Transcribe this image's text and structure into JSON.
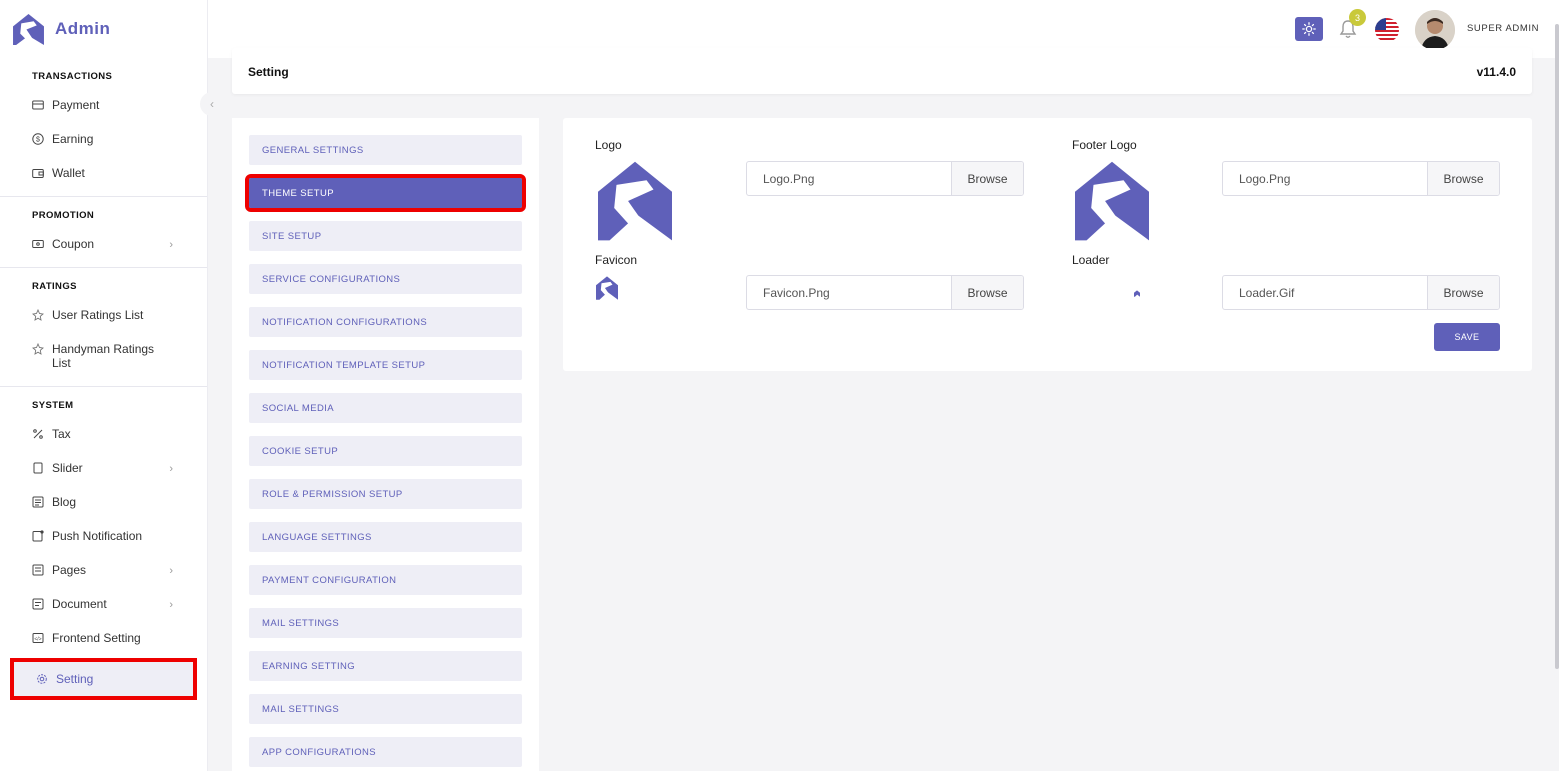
{
  "app": {
    "brand": "Admin"
  },
  "sidebar": {
    "sections": [
      {
        "title": "TRANSACTIONS",
        "items": [
          {
            "label": "Payment",
            "icon": "payment-icon"
          },
          {
            "label": "Earning",
            "icon": "earning-icon"
          },
          {
            "label": "Wallet",
            "icon": "wallet-icon"
          }
        ]
      },
      {
        "title": "PROMOTION",
        "items": [
          {
            "label": "Coupon",
            "icon": "coupon-icon",
            "has_children": true
          }
        ]
      },
      {
        "title": "RATINGS",
        "items": [
          {
            "label": "User Ratings List",
            "icon": "rating-icon"
          },
          {
            "label": "Handyman Ratings List",
            "icon": "rating-icon"
          }
        ]
      },
      {
        "title": "SYSTEM",
        "items": [
          {
            "label": "Tax",
            "icon": "percent-icon"
          },
          {
            "label": "Slider",
            "icon": "slider-icon",
            "has_children": true
          },
          {
            "label": "Blog",
            "icon": "blog-icon"
          },
          {
            "label": "Push Notification",
            "icon": "push-notification-icon"
          },
          {
            "label": "Pages",
            "icon": "pages-icon",
            "has_children": true
          },
          {
            "label": "Document",
            "icon": "document-icon",
            "has_children": true
          },
          {
            "label": "Frontend Setting",
            "icon": "frontend-icon"
          },
          {
            "label": "Setting",
            "icon": "gear-icon",
            "active": true
          }
        ]
      }
    ]
  },
  "header": {
    "notification_count": "3",
    "username": "SUPER ADMIN"
  },
  "page": {
    "title": "Setting",
    "version": "v11.4.0"
  },
  "settings_tabs": [
    "GENERAL SETTINGS",
    "THEME SETUP",
    "SITE SETUP",
    "SERVICE CONFIGURATIONS",
    "NOTIFICATION CONFIGURATIONS",
    "NOTIFICATION TEMPLATE SETUP",
    "SOCIAL MEDIA",
    "COOKIE SETUP",
    "ROLE & PERMISSION SETUP",
    "LANGUAGE SETTINGS",
    "PAYMENT CONFIGURATION",
    "MAIL SETTINGS",
    "EARNING SETTING",
    "MAIL SETTINGS",
    "APP CONFIGURATIONS"
  ],
  "active_tab": "THEME SETUP",
  "theme": {
    "logo_label": "Logo",
    "logo_file": "Logo.Png",
    "footer_logo_label": "Footer Logo",
    "footer_logo_file": "Logo.Png",
    "favicon_label": "Favicon",
    "favicon_file": "Favicon.Png",
    "loader_label": "Loader",
    "loader_file": "Loader.Gif",
    "browse_label": "Browse",
    "save_label": "SAVE"
  },
  "colors": {
    "accent": "#5f60b9",
    "highlight": "#ee0000"
  }
}
